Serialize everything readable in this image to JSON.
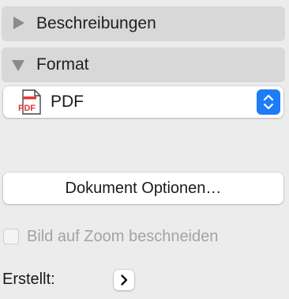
{
  "sections": {
    "descriptions": {
      "label": "Beschreibungen",
      "expanded": false
    },
    "format": {
      "label": "Format",
      "expanded": true
    }
  },
  "format_popup": {
    "selected": "PDF",
    "icon_text": "PDF",
    "icon": "pdf-file-icon",
    "accent": "#1f7cf7"
  },
  "document_options_button": {
    "label": "Dokument Optionen…"
  },
  "crop_to_zoom": {
    "label": "Bild auf Zoom beschneiden",
    "checked": false,
    "enabled": false
  },
  "created": {
    "label": "Erstellt:",
    "icon": "chevron-right-icon"
  }
}
